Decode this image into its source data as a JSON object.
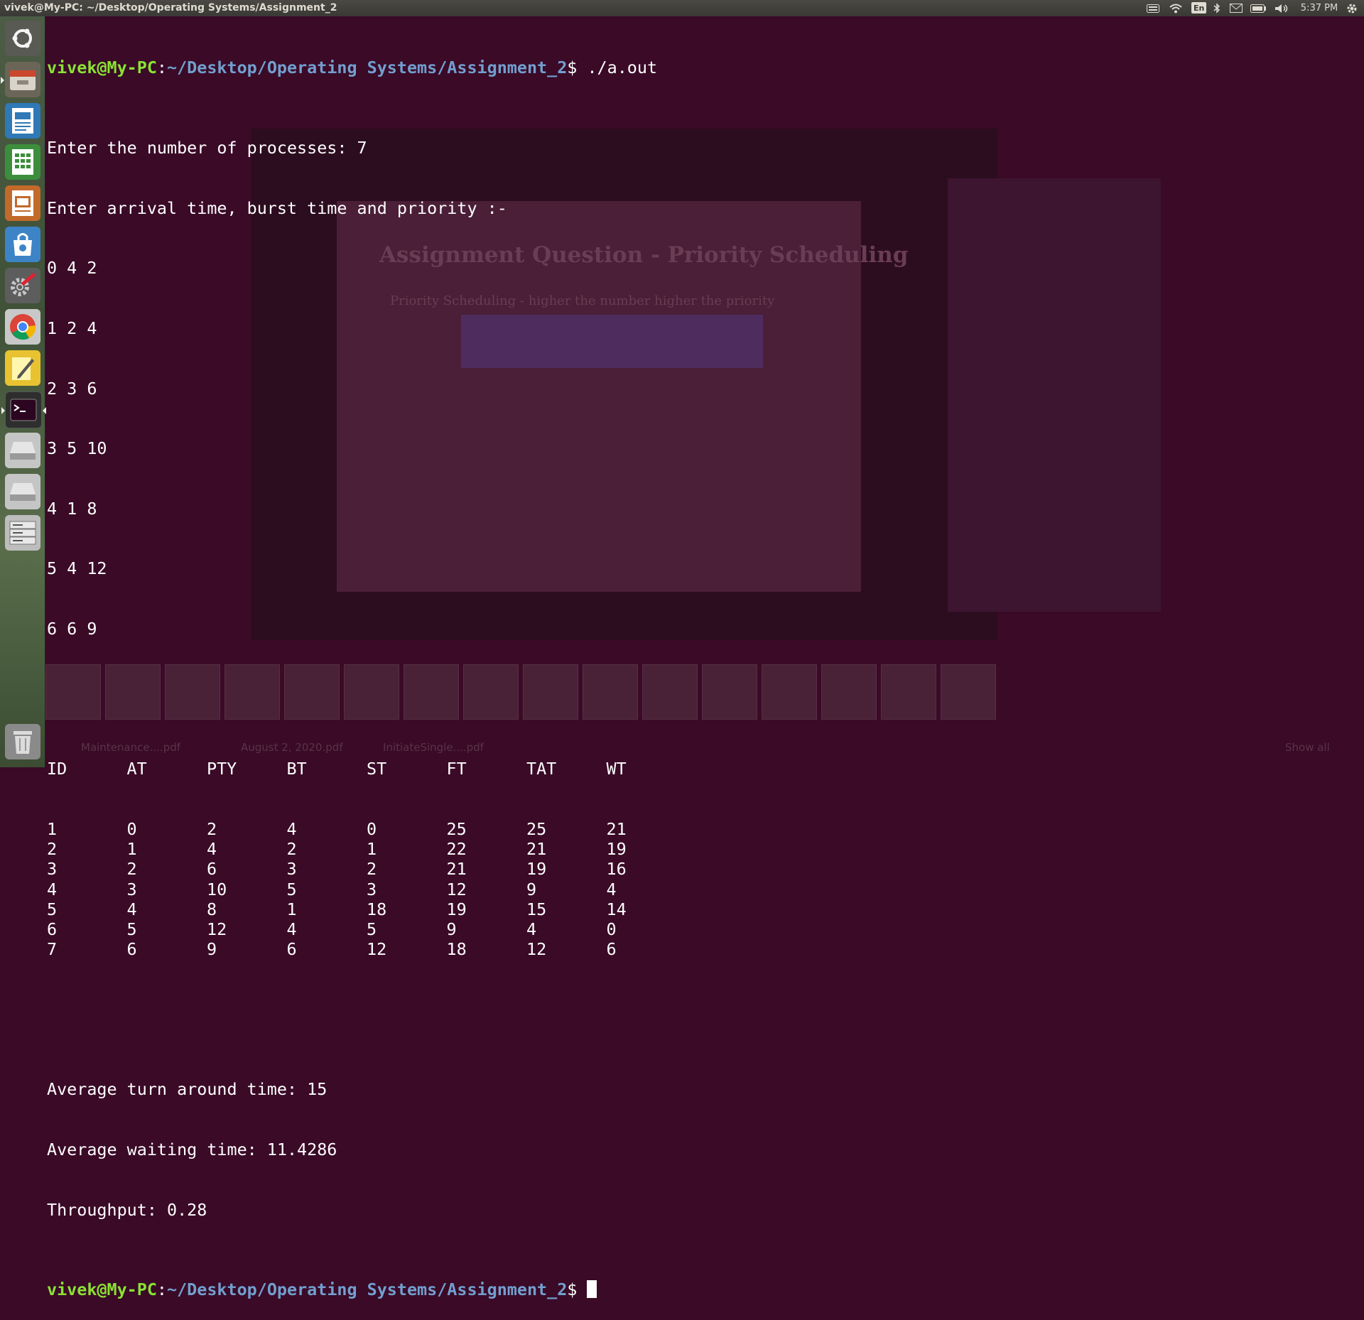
{
  "panel": {
    "window_title": "vivek@My-PC: ~/Desktop/Operating Systems/Assignment_2",
    "keyboard_layout": "En",
    "clock": "5:37 PM"
  },
  "launcher": {
    "items": [
      {
        "name": "dash-home",
        "icon": "ubuntu-logo-icon"
      },
      {
        "name": "files",
        "icon": "file-manager-icon"
      },
      {
        "name": "libreoffice-writer",
        "icon": "writer-document-icon"
      },
      {
        "name": "libreoffice-calc",
        "icon": "calc-spreadsheet-icon"
      },
      {
        "name": "libreoffice-impress",
        "icon": "impress-presentation-icon"
      },
      {
        "name": "software-center",
        "icon": "software-bag-icon"
      },
      {
        "name": "system-settings",
        "icon": "settings-gear-wrench-icon"
      },
      {
        "name": "chrome",
        "icon": "chrome-icon"
      },
      {
        "name": "text-editor",
        "icon": "notepad-pencil-icon"
      },
      {
        "name": "terminal",
        "icon": "terminal-icon"
      },
      {
        "name": "drive-1",
        "icon": "hard-drive-icon"
      },
      {
        "name": "drive-2",
        "icon": "hard-drive-icon"
      },
      {
        "name": "drive-3",
        "icon": "server-drive-icon"
      },
      {
        "name": "trash",
        "icon": "trash-icon"
      }
    ]
  },
  "terminal": {
    "prompt_user": "vivek@My-PC",
    "prompt_colon": ":",
    "prompt_path": "~/Desktop/Operating Systems/Assignment_2",
    "prompt_symbol": "$ ",
    "command": "./a.out",
    "output_lines": [
      "Enter the number of processes: 7",
      "Enter arrival time, burst time and priority :-",
      "0 4 2",
      "1 2 4",
      "2 3 6",
      "3 5 10",
      "4 1 8",
      "5 4 12",
      "6 6 9"
    ],
    "table": {
      "headers": [
        "ID",
        "AT",
        "PTY",
        "BT",
        "ST",
        "FT",
        "TAT",
        "WT"
      ],
      "rows": [
        [
          "1",
          "0",
          "2",
          "4",
          "0",
          "25",
          "25",
          "21"
        ],
        [
          "2",
          "1",
          "4",
          "2",
          "1",
          "22",
          "21",
          "19"
        ],
        [
          "3",
          "2",
          "6",
          "3",
          "2",
          "21",
          "19",
          "16"
        ],
        [
          "4",
          "3",
          "10",
          "5",
          "3",
          "12",
          "9",
          "4"
        ],
        [
          "5",
          "4",
          "8",
          "1",
          "18",
          "19",
          "15",
          "14"
        ],
        [
          "6",
          "5",
          "12",
          "4",
          "5",
          "9",
          "4",
          "0"
        ],
        [
          "7",
          "6",
          "9",
          "6",
          "12",
          "18",
          "12",
          "6"
        ]
      ]
    },
    "summary": [
      "Average turn around time: 15",
      "Average waiting time: 11.4286",
      "Throughput: 0.28"
    ]
  },
  "background": {
    "slide_heading": "Assignment Question - Priority Scheduling",
    "slide_subtitle": "Priority Scheduling - higher the number higher the priority",
    "downloads": [
      "Maintenance....pdf",
      "August 2, 2020.pdf",
      "InitiateSingle....pdf"
    ],
    "show_all": "Show all"
  },
  "colors": {
    "terminal_bg": "#300a24",
    "prompt_user": "#8ae234",
    "prompt_path": "#729fcf",
    "text": "#ffffff"
  }
}
